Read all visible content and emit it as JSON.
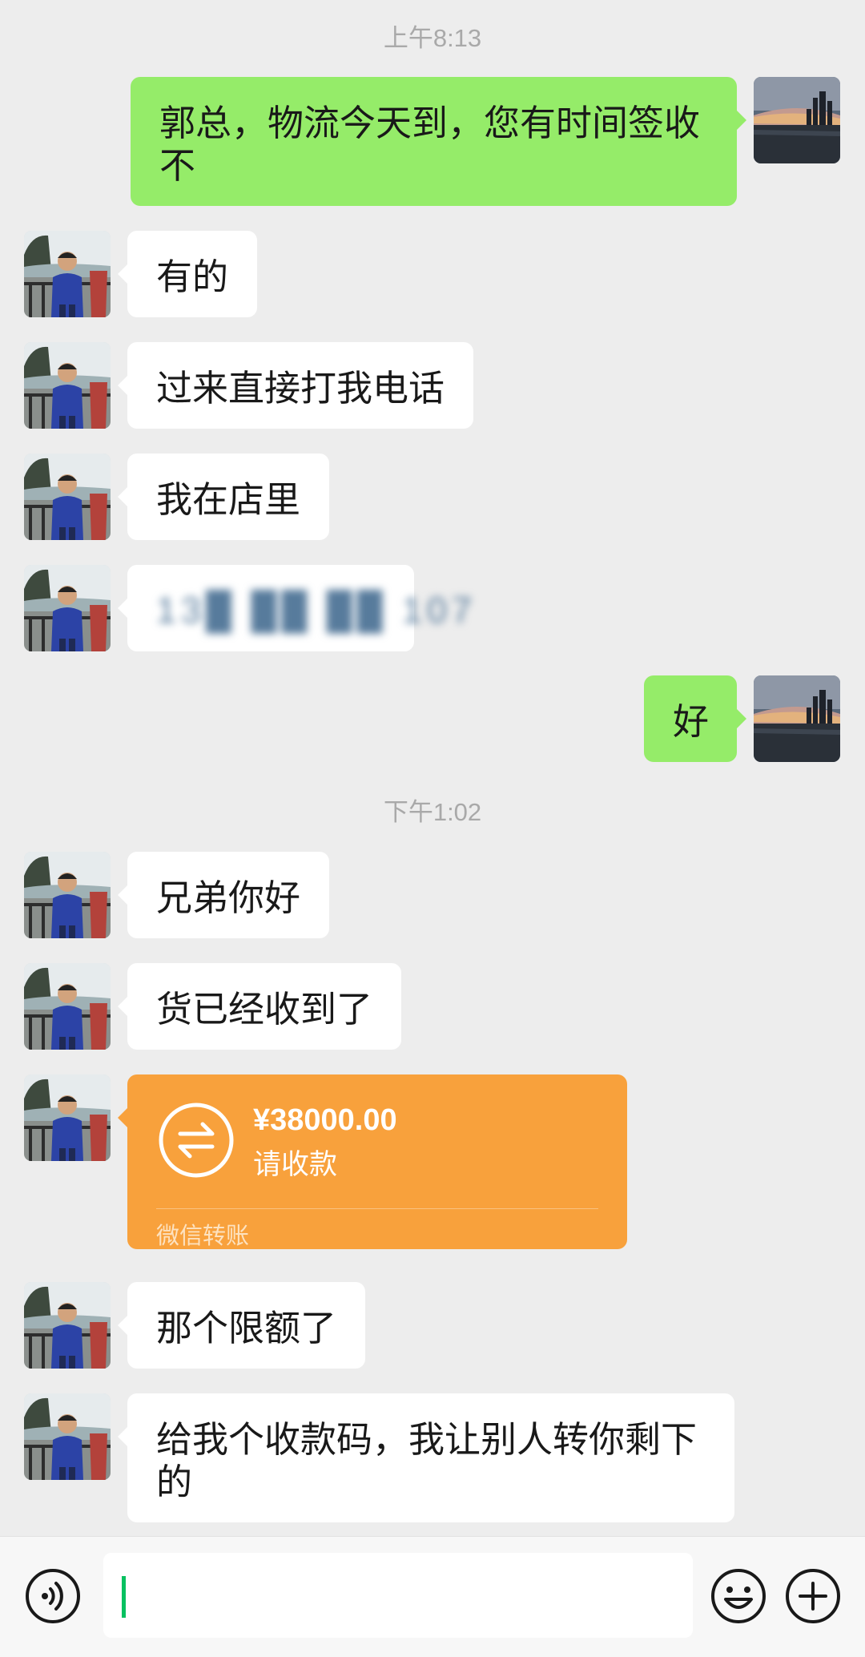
{
  "timestamps": [
    "上午8:13",
    "下午1:02"
  ],
  "messages": {
    "m1": "郭总，物流今天到，您有时间签收不",
    "m2": "有的",
    "m3": "过来直接打我电话",
    "m4": "我在店里",
    "m5": "13█ ██ ██ 107",
    "m6": "好",
    "m7": "兄弟你好",
    "m8": "货已经收到了",
    "m10": "那个限额了",
    "m11": "给我个收款码，我让别人转你剩下的"
  },
  "transfer": {
    "amount": "¥38000.00",
    "status": "请收款",
    "footer": "微信转账",
    "color": "#f8a13c"
  },
  "input_bar": {
    "input_value": "",
    "icons": [
      "voice-icon",
      "emoji-icon",
      "plus-icon"
    ]
  },
  "colors": {
    "background": "#ededed",
    "incoming_bubble": "#ffffff",
    "outgoing_bubble": "#95ec69",
    "cursor": "#07c160"
  }
}
